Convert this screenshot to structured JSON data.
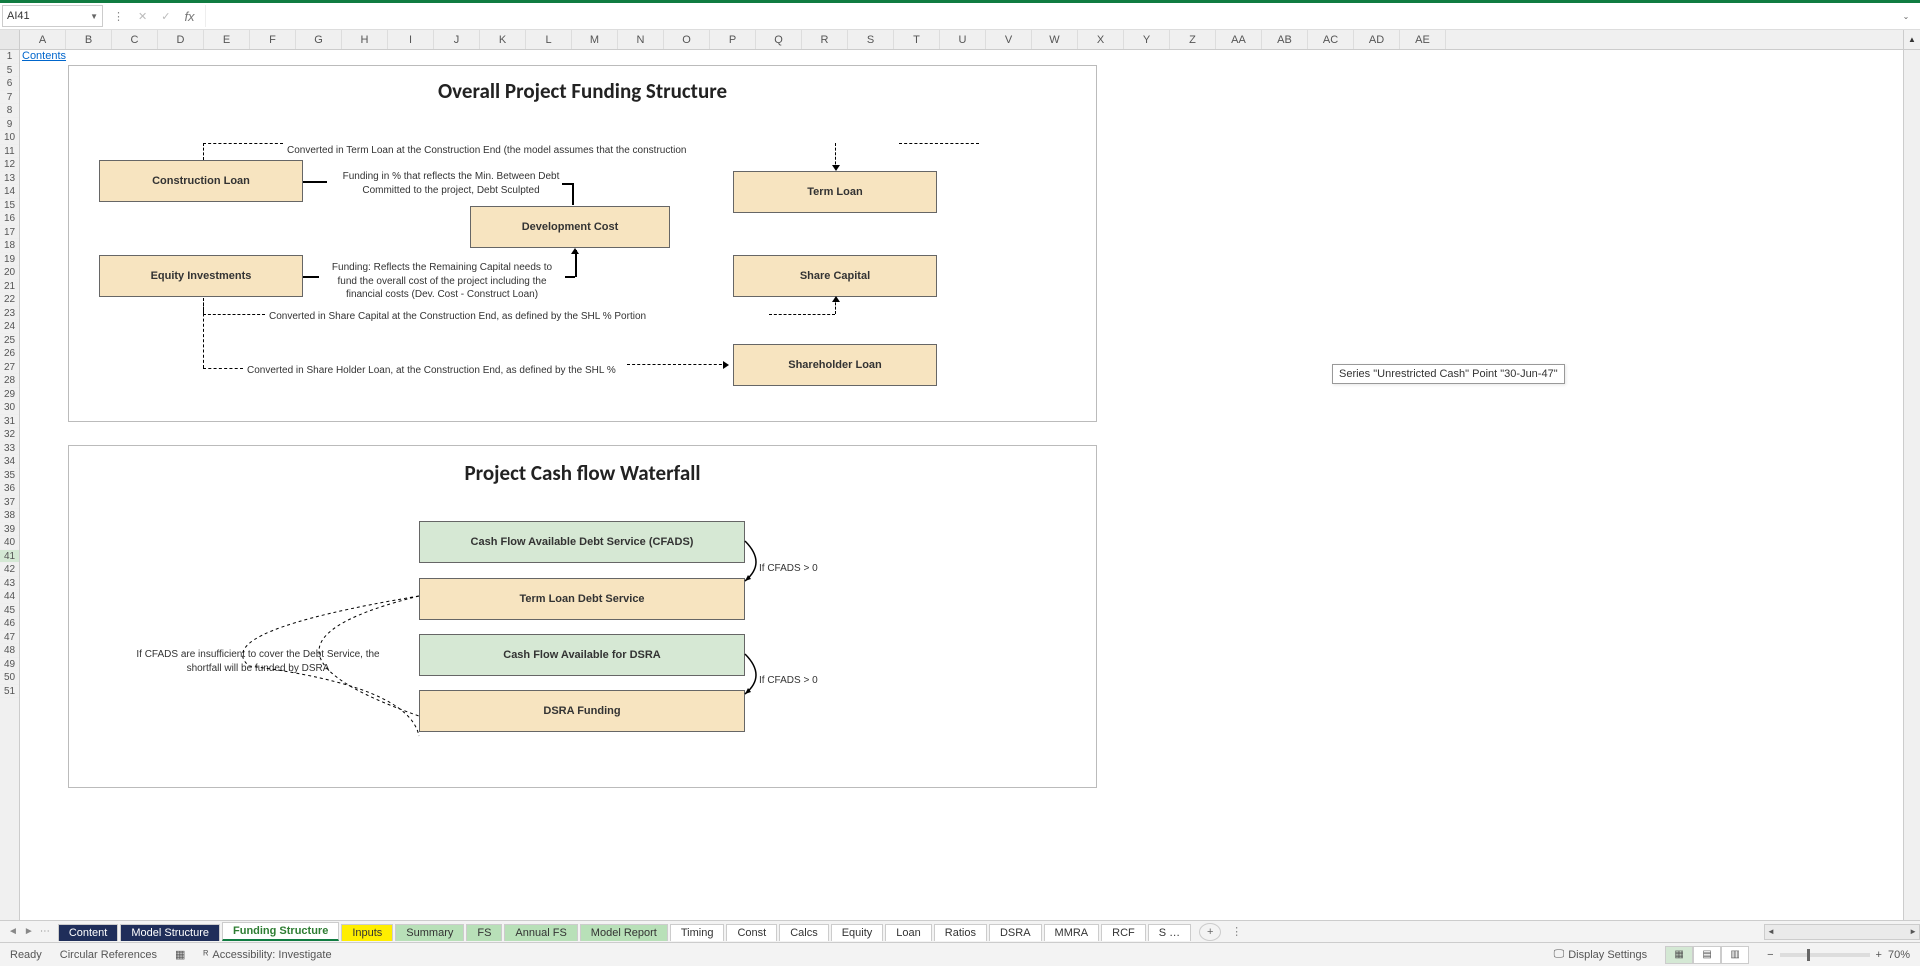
{
  "formula": {
    "cell_ref": "AI41",
    "fx_label": "fx"
  },
  "cols": [
    "A",
    "B",
    "C",
    "D",
    "E",
    "F",
    "G",
    "H",
    "I",
    "J",
    "K",
    "L",
    "M",
    "N",
    "O",
    "P",
    "Q",
    "R",
    "S",
    "T",
    "U",
    "V",
    "W",
    "X",
    "Y",
    "Z",
    "AA",
    "AB",
    "AC",
    "AD",
    "AE"
  ],
  "rows": [
    "1",
    "5",
    "6",
    "7",
    "8",
    "9",
    "10",
    "11",
    "12",
    "13",
    "14",
    "15",
    "16",
    "17",
    "18",
    "19",
    "20",
    "21",
    "22",
    "23",
    "24",
    "25",
    "26",
    "27",
    "28",
    "29",
    "30",
    "31",
    "32",
    "33",
    "34",
    "35",
    "36",
    "37",
    "38",
    "39",
    "40",
    "41",
    "42",
    "43",
    "44",
    "45",
    "46",
    "47",
    "48",
    "49",
    "50",
    "51"
  ],
  "contents_link": "Contents",
  "diagram1": {
    "title": "Overall Project Funding Structure",
    "boxes": {
      "construction_loan": "Construction Loan",
      "equity_investments": "Equity Investments",
      "development_cost": "Development Cost",
      "term_loan": "Term Loan",
      "share_capital": "Share Capital",
      "shareholder_loan": "Shareholder Loan"
    },
    "annotations": {
      "conv_term": "Converted in Term Loan at the Construction End (the model assumes that the construction",
      "funding_pct": "Funding in % that reflects the Min. Between Debt Committed to the project, Debt Sculpted",
      "funding_remain": "Funding: Reflects the Remaining Capital  needs to fund the overall cost of the project including the financial costs  (Dev. Cost - Construct Loan)",
      "conv_share_cap": "Converted in Share Capital at the Construction End, as defined by the SHL %  Portion",
      "conv_shl": "Converted in Share Holder Loan, at the Construction End, as defined by the SHL %"
    }
  },
  "diagram2": {
    "title": "Project Cash flow Waterfall",
    "boxes": {
      "cfads": "Cash Flow Available Debt Service (CFADS)",
      "term_debt_service": "Term Loan Debt Service",
      "cf_dsra": "Cash Flow Available for DSRA",
      "dsra_funding": "DSRA Funding"
    },
    "annotations": {
      "if_cfads1": "If CFADS > 0",
      "if_cfads2": "If CFADS > 0",
      "insufficient": "If CFADS are insufficient to cover the Debt Service, the shortfall will be funded by DSRA"
    }
  },
  "tooltip": "Series \"Unrestricted Cash\" Point \"30-Jun-47\"",
  "tabs": [
    {
      "label": "Content",
      "cls": "darkblue"
    },
    {
      "label": "Model Structure",
      "cls": "darkblue"
    },
    {
      "label": "Funding Structure",
      "cls": "active"
    },
    {
      "label": "Inputs",
      "cls": "yellow"
    },
    {
      "label": "Summary",
      "cls": "lgreen"
    },
    {
      "label": "FS",
      "cls": "lgreen"
    },
    {
      "label": "Annual FS",
      "cls": "lgreen"
    },
    {
      "label": "Model Report",
      "cls": "lgreen"
    },
    {
      "label": "Timing",
      "cls": ""
    },
    {
      "label": "Const",
      "cls": ""
    },
    {
      "label": "Calcs",
      "cls": ""
    },
    {
      "label": "Equity",
      "cls": ""
    },
    {
      "label": "Loan",
      "cls": ""
    },
    {
      "label": "Ratios",
      "cls": ""
    },
    {
      "label": "DSRA",
      "cls": ""
    },
    {
      "label": "MMRA",
      "cls": ""
    },
    {
      "label": "RCF",
      "cls": ""
    },
    {
      "label": "S …",
      "cls": ""
    }
  ],
  "status": {
    "ready": "Ready",
    "circ": "Circular References",
    "access": "Accessibility: Investigate",
    "display": "Display Settings",
    "zoom": "70%"
  },
  "chart_data": {
    "type": "diagram",
    "diagrams": [
      {
        "title": "Overall Project Funding Structure",
        "nodes": [
          "Construction Loan",
          "Equity Investments",
          "Development Cost",
          "Term Loan",
          "Share Capital",
          "Shareholder Loan"
        ],
        "edges": [
          {
            "from": "Construction Loan",
            "to": "Development Cost",
            "label": "Funding in % that reflects the Min. Between Debt Committed to the project, Debt Sculpted"
          },
          {
            "from": "Equity Investments",
            "to": "Development Cost",
            "label": "Funding: Reflects the Remaining Capital needs to fund the overall cost of the project including the financial costs (Dev. Cost - Construct Loan)"
          },
          {
            "from": "Construction Loan",
            "to": "Term Loan",
            "label": "Converted in Term Loan at the Construction End (the model assumes that the construction",
            "style": "dashed"
          },
          {
            "from": "Equity Investments",
            "to": "Share Capital",
            "label": "Converted in Share Capital at the Construction End, as defined by the SHL % Portion",
            "style": "dashed"
          },
          {
            "from": "Equity Investments",
            "to": "Shareholder Loan",
            "label": "Converted in Share Holder Loan, at the Construction End, as defined by the SHL %",
            "style": "dashed"
          }
        ]
      },
      {
        "title": "Project Cash flow Waterfall",
        "nodes": [
          "Cash Flow Available Debt Service (CFADS)",
          "Term Loan Debt Service",
          "Cash Flow Available for DSRA",
          "DSRA Funding"
        ],
        "edges": [
          {
            "from": "Cash Flow Available Debt Service (CFADS)",
            "to": "Term Loan Debt Service",
            "label": "If CFADS > 0"
          },
          {
            "from": "Cash Flow Available for DSRA",
            "to": "DSRA Funding",
            "label": "If CFADS > 0"
          },
          {
            "from": "DSRA Funding",
            "to": "Term Loan Debt Service",
            "label": "If CFADS are insufficient to cover the Debt Service, the shortfall will be funded by DSRA",
            "style": "dashed"
          }
        ]
      }
    ]
  }
}
